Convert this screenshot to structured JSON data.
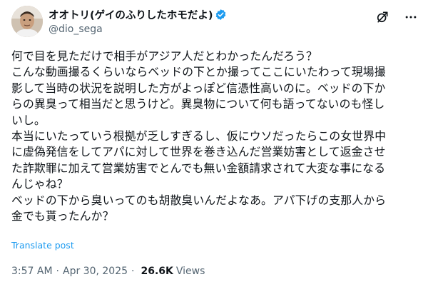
{
  "user": {
    "display_name": "オオトリ(ゲイのふりしたホモだよ)",
    "handle": "@dio_sega"
  },
  "icons": {
    "verified": "verified-badge-icon",
    "grok": "grok-icon",
    "more": "more-options-icon"
  },
  "colors": {
    "accent": "#1d9bf0",
    "text": "#0f1419",
    "secondary": "#536471"
  },
  "tweet": {
    "lines": [
      "何で目を見ただけで相手がアジア人だとわかったんだろう？",
      "こんな動画撮るくらいならベッドの下とか撮ってここにいたわって現場撮",
      "影して当時の状況を説明した方がよっぽど信憑性高いのに。ベッドの下か",
      "らの異臭って相当だと思うけど。異臭物について何も語ってないのも怪し",
      "いし。",
      "本当にいたっていう根拠が乏しすぎるし、仮にウソだったらこの女世界中",
      "に虚偽発信をしてアパに対して世界を巻き込んだ営業妨害として返金させ",
      "た詐欺罪に加えて営業妨害でとんでも無い金額請求されて大変な事になる",
      "んじゃね？",
      "ベッドの下から臭いってのも胡散臭いんだよなあ。アパ下げの支那人から",
      "金でも貰ったんか？"
    ],
    "translate_label": "Translate post",
    "time": "3:57 AM",
    "separator": "·",
    "date": "Apr 30, 2025",
    "views_count": "26.6K",
    "views_label": "Views"
  }
}
